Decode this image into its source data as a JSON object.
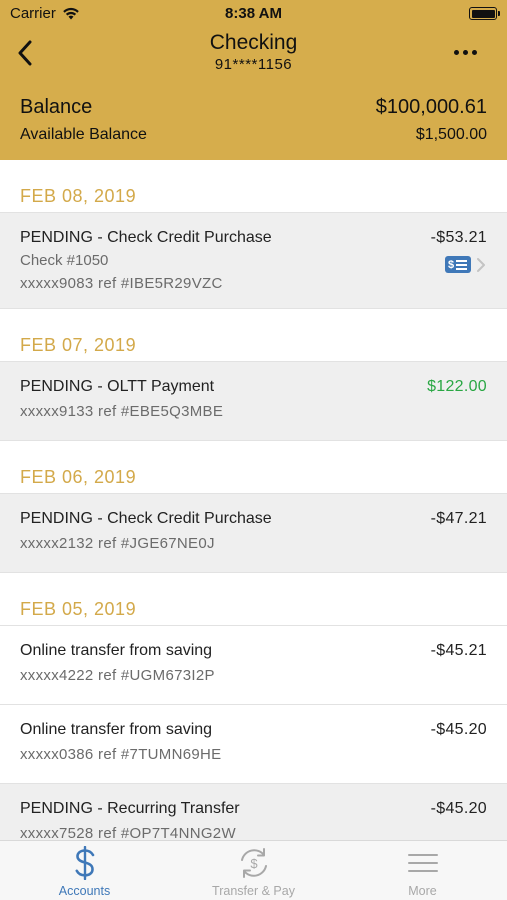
{
  "status_bar": {
    "carrier": "Carrier",
    "time": "8:38 AM"
  },
  "nav": {
    "title": "Checking",
    "account_number": "91****1156"
  },
  "balance": {
    "label": "Balance",
    "value": "$100,000.61",
    "available_label": "Available Balance",
    "available_value": "$1,500.00"
  },
  "groups": [
    {
      "date": "FEB 08, 2019",
      "transactions": [
        {
          "title": "PENDING - Check Credit Purchase",
          "check": "Check #1050",
          "ref": "xxxxx9083 ref #IBE5R29VZC",
          "amount": "-$53.21"
        }
      ]
    },
    {
      "date": "FEB 07, 2019",
      "transactions": [
        {
          "title": "PENDING - OLTT Payment",
          "ref": "xxxxx9133 ref #EBE5Q3MBE",
          "amount": "$122.00"
        }
      ]
    },
    {
      "date": "FEB 06, 2019",
      "transactions": [
        {
          "title": "PENDING - Check Credit Purchase",
          "ref": "xxxxx2132 ref #JGE67NE0J",
          "amount": "-$47.21"
        }
      ]
    },
    {
      "date": "FEB 05, 2019",
      "transactions": [
        {
          "title": "Online transfer from saving",
          "ref": "xxxxx4222 ref #UGM673I2P",
          "amount": "-$45.21"
        },
        {
          "title": "Online transfer from saving",
          "ref": "xxxxx0386 ref #7TUMN69HE",
          "amount": "-$45.20"
        },
        {
          "title": "PENDING - Recurring Transfer",
          "ref": "xxxxx7528 ref #OP7T4NNG2W",
          "amount": "-$45.20"
        }
      ]
    }
  ],
  "tabs": [
    {
      "label": "Accounts",
      "icon": "dollar-icon"
    },
    {
      "label": "Transfer & Pay",
      "icon": "transfer-pay-icon"
    },
    {
      "label": "More",
      "icon": "hamburger-menu-icon"
    }
  ],
  "colors": {
    "header_gold": "#d6ad4c",
    "date_gold": "#d3a94a",
    "credit_green": "#2aa744",
    "active_blue": "#3f78b8"
  }
}
